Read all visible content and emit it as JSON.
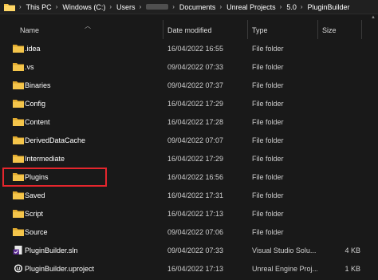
{
  "breadcrumb": {
    "items": [
      "This PC",
      "Windows (C:)",
      "Users",
      "",
      "Documents",
      "Unreal Projects",
      "5.0",
      "PluginBuilder"
    ]
  },
  "columns": {
    "name": "Name",
    "date": "Date modified",
    "type": "Type",
    "size": "Size"
  },
  "rows": [
    {
      "name": ".idea",
      "date": "16/04/2022 16:55",
      "type": "File folder",
      "size": "",
      "icon": "folder-icon"
    },
    {
      "name": ".vs",
      "date": "09/04/2022 07:33",
      "type": "File folder",
      "size": "",
      "icon": "folder-icon"
    },
    {
      "name": "Binaries",
      "date": "09/04/2022 07:37",
      "type": "File folder",
      "size": "",
      "icon": "folder-icon"
    },
    {
      "name": "Config",
      "date": "16/04/2022 17:29",
      "type": "File folder",
      "size": "",
      "icon": "folder-icon"
    },
    {
      "name": "Content",
      "date": "16/04/2022 17:28",
      "type": "File folder",
      "size": "",
      "icon": "folder-icon"
    },
    {
      "name": "DerivedDataCache",
      "date": "09/04/2022 07:07",
      "type": "File folder",
      "size": "",
      "icon": "folder-icon"
    },
    {
      "name": "Intermediate",
      "date": "16/04/2022 17:29",
      "type": "File folder",
      "size": "",
      "icon": "folder-icon"
    },
    {
      "name": "Plugins",
      "date": "16/04/2022 16:56",
      "type": "File folder",
      "size": "",
      "icon": "folder-icon"
    },
    {
      "name": "Saved",
      "date": "16/04/2022 17:31",
      "type": "File folder",
      "size": "",
      "icon": "folder-icon"
    },
    {
      "name": "Script",
      "date": "16/04/2022 17:13",
      "type": "File folder",
      "size": "",
      "icon": "folder-icon"
    },
    {
      "name": "Source",
      "date": "09/04/2022 07:06",
      "type": "File folder",
      "size": "",
      "icon": "folder-icon"
    },
    {
      "name": "PluginBuilder.sln",
      "date": "09/04/2022 07:33",
      "type": "Visual Studio Solu...",
      "size": "4 KB",
      "icon": "sln-file-icon"
    },
    {
      "name": "PluginBuilder.uproject",
      "date": "16/04/2022 17:13",
      "type": "Unreal Engine Proj...",
      "size": "1 KB",
      "icon": "uproject-file-icon"
    }
  ],
  "colors": {
    "background": "#191919",
    "folder": "#f4c54b",
    "highlight": "#e5262d"
  }
}
